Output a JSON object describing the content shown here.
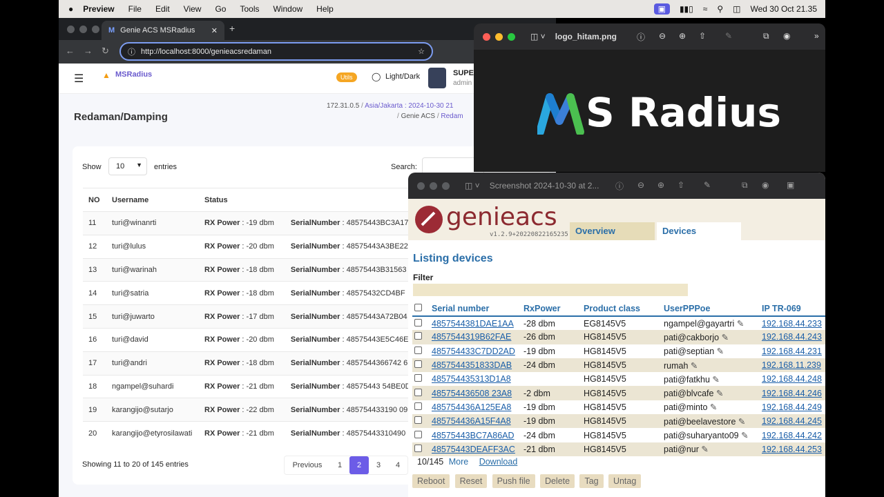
{
  "menubar": {
    "apple": "",
    "app": "Preview",
    "items": [
      "File",
      "Edit",
      "View",
      "Go",
      "Tools",
      "Window",
      "Help"
    ],
    "clock": "Wed 30 Oct  21.35"
  },
  "browser": {
    "tab_title": "Genie ACS MSRadius",
    "url": "http://localhost:8000/genieacsredaman",
    "brand": "MSRadius",
    "util_badge": "Utils",
    "theme_toggle": "Light/Dark",
    "user_name": "SUPER",
    "user_role": "admin",
    "page_title": "Redaman/Damping",
    "ip": "172.31.0.5",
    "breadcrumb_tz": "Asia/Jakarta : 2024-10-30 21",
    "breadcrumb_a": "Genie ACS",
    "breadcrumb_b": "Redam",
    "show_label": "Show",
    "entries_value": "10",
    "entries_label": "entries",
    "search_label": "Search:",
    "columns": [
      "NO",
      "Username",
      "Status"
    ],
    "rows": [
      {
        "no": "11",
        "user": "turi@winanrti",
        "rx": "-19 dbm",
        "sn": "48575443BC3A17"
      },
      {
        "no": "12",
        "user": "turi@lulus",
        "rx": "-20 dbm",
        "sn": "48575443A3BE22"
      },
      {
        "no": "13",
        "user": "turi@warinah",
        "rx": "-18 dbm",
        "sn": "48575443B31563"
      },
      {
        "no": "14",
        "user": "turi@satria",
        "rx": "-18 dbm",
        "sn": "48575432CD4BF"
      },
      {
        "no": "15",
        "user": "turi@juwarto",
        "rx": "-17 dbm",
        "sn": "48575443A72B04"
      },
      {
        "no": "16",
        "user": "turi@david",
        "rx": "-20 dbm",
        "sn": "48575443E5C46E"
      },
      {
        "no": "17",
        "user": "turi@andri",
        "rx": "-18 dbm",
        "sn": "4857544366742 6"
      },
      {
        "no": "18",
        "user": "ngampel@suhardi",
        "rx": "-21 dbm",
        "sn": "48575443 54BE0D"
      },
      {
        "no": "19",
        "user": "karangijo@sutarjo",
        "rx": "-22 dbm",
        "sn": "485754433190 09"
      },
      {
        "no": "20",
        "user": "karangijo@etyrosilawati",
        "rx": "-21 dbm",
        "sn": "48575443310490"
      }
    ],
    "rx_label": "RX Power",
    "sn_label": "SerialNumber",
    "showing": "Showing 11 to 20 of 145 entries",
    "prev_btn": "Previous",
    "pages": [
      "1",
      "2",
      "3",
      "4"
    ]
  },
  "preview1": {
    "filename": "logo_hitam.png",
    "logo_text": "S Radius"
  },
  "preview2": {
    "filename": "Screenshot 2024-10-30 at 2...",
    "brand": "genieacs",
    "version": "v1.2.9+20220822165235",
    "nav": [
      "Overview",
      "Devices"
    ],
    "heading": "Listing devices",
    "filter_label": "Filter",
    "columns": [
      "Serial number",
      "RxPower",
      "Product class",
      "UserPPPoe",
      "IP TR-069"
    ],
    "devices": [
      {
        "sn": "4857544381DAE1AA",
        "rx": "-28 dbm",
        "pc": "EG8145V5",
        "user": "ngampel@gayartri",
        "ip": "192.168.44.233"
      },
      {
        "sn": "4857544319B62FAE",
        "rx": "-26 dbm",
        "pc": "HG8145V5",
        "user": "pati@cakborjo",
        "ip": "192.168.44.243"
      },
      {
        "sn": "485754433C7DD2AD",
        "rx": "-19 dbm",
        "pc": "HG8145V5",
        "user": "pati@septian",
        "ip": "192.168.44.231"
      },
      {
        "sn": "4857544351833DAB",
        "rx": "-24 dbm",
        "pc": "HG8145V5",
        "user": "rumah",
        "ip": "192.168.11.239"
      },
      {
        "sn": "485754435313D1A8",
        "rx": "",
        "pc": "HG8145V5",
        "user": "pati@fatkhu",
        "ip": "192.168.44.248"
      },
      {
        "sn": "485754436508 23A8",
        "rx": "-2 dbm",
        "pc": "HG8145V5",
        "user": "pati@blvcafe",
        "ip": "192.168.44.246"
      },
      {
        "sn": "485754436A125EA8",
        "rx": "-19 dbm",
        "pc": "HG8145V5",
        "user": "pati@minto",
        "ip": "192.168.44.249"
      },
      {
        "sn": "485754436A15F4A8",
        "rx": "-19 dbm",
        "pc": "HG8145V5",
        "user": "pati@beelavestore",
        "ip": "192.168.44.245"
      },
      {
        "sn": "48575443BC7A86AD",
        "rx": "-24 dbm",
        "pc": "HG8145V5",
        "user": "pati@suharyanto09",
        "ip": "192.168.44.242"
      },
      {
        "sn": "48575443DEAFF3AC",
        "rx": "-21 dbm",
        "pc": "HG8145V5",
        "user": "pati@nur",
        "ip": "192.168.44.253"
      }
    ],
    "count": "10/145",
    "more": "More",
    "download": "Download",
    "actions": [
      "Reboot",
      "Reset",
      "Push file",
      "Delete",
      "Tag",
      "Untag"
    ]
  }
}
